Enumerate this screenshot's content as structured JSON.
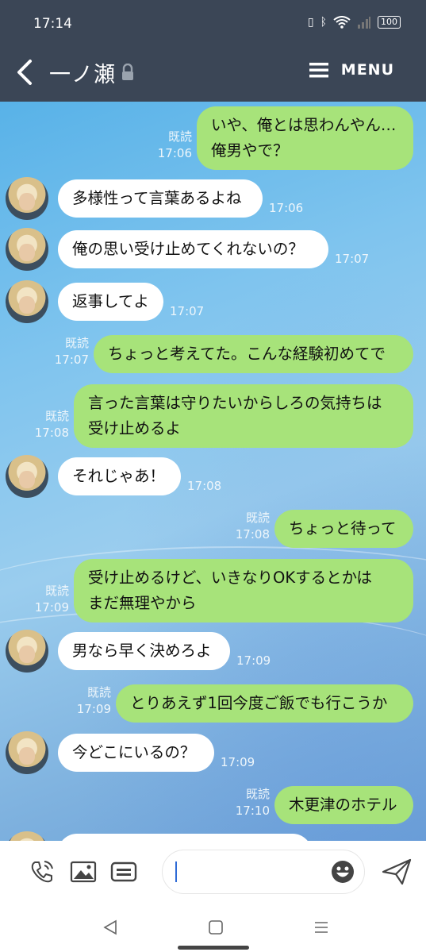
{
  "status": {
    "time": "17:14",
    "battery": "100"
  },
  "header": {
    "title": "一ノ瀬",
    "menu_label": "MENU"
  },
  "messages": [
    {
      "dir": "out",
      "lines": [
        "いや、俺とは思わんやん…",
        "俺男やで？"
      ],
      "read": "既読",
      "time": "17:06"
    },
    {
      "dir": "in",
      "lines": [
        "多様性って言葉あるよね"
      ],
      "time": "17:06"
    },
    {
      "dir": "in",
      "lines": [
        "俺の思い受け止めてくれないの？"
      ],
      "time": "17:07"
    },
    {
      "dir": "in",
      "lines": [
        "返事してよ"
      ],
      "time": "17:07"
    },
    {
      "dir": "out",
      "lines": [
        "ちょっと考えてた。こんな経験初めてで"
      ],
      "read": "既読",
      "time": "17:07"
    },
    {
      "dir": "out",
      "lines": [
        "言った言葉は守りたいからしろの気持ちは",
        "受け止めるよ"
      ],
      "read": "既読",
      "time": "17:08"
    },
    {
      "dir": "in",
      "lines": [
        "それじゃあ！"
      ],
      "time": "17:08"
    },
    {
      "dir": "out",
      "lines": [
        "ちょっと待って"
      ],
      "read": "既読",
      "time": "17:08"
    },
    {
      "dir": "out",
      "lines": [
        "受け止めるけど、いきなりOKするとかは",
        "まだ無理やから"
      ],
      "read": "既読",
      "time": "17:09"
    },
    {
      "dir": "in",
      "lines": [
        "男なら早く決めろよ"
      ],
      "time": "17:09"
    },
    {
      "dir": "out",
      "lines": [
        "とりあえず1回今度ご飯でも行こうか"
      ],
      "read": "既読",
      "time": "17:09"
    },
    {
      "dir": "in",
      "lines": [
        "今どこにいるの？"
      ],
      "time": "17:09"
    },
    {
      "dir": "out",
      "lines": [
        "木更津のホテル"
      ],
      "read": "既読",
      "time": "17:10"
    }
  ],
  "composer": {
    "icons": [
      "phone-icon",
      "image-icon",
      "keyboard-icon",
      "emoji-icon",
      "send-icon"
    ],
    "input_value": ""
  },
  "nav": {
    "icons": [
      "back-nav-icon",
      "home-nav-icon",
      "recents-nav-icon"
    ]
  },
  "colors": {
    "header": "#3b4656",
    "out_bubble": "#a7e37a",
    "in_bubble": "#ffffff",
    "caret": "#2f6bd6"
  }
}
